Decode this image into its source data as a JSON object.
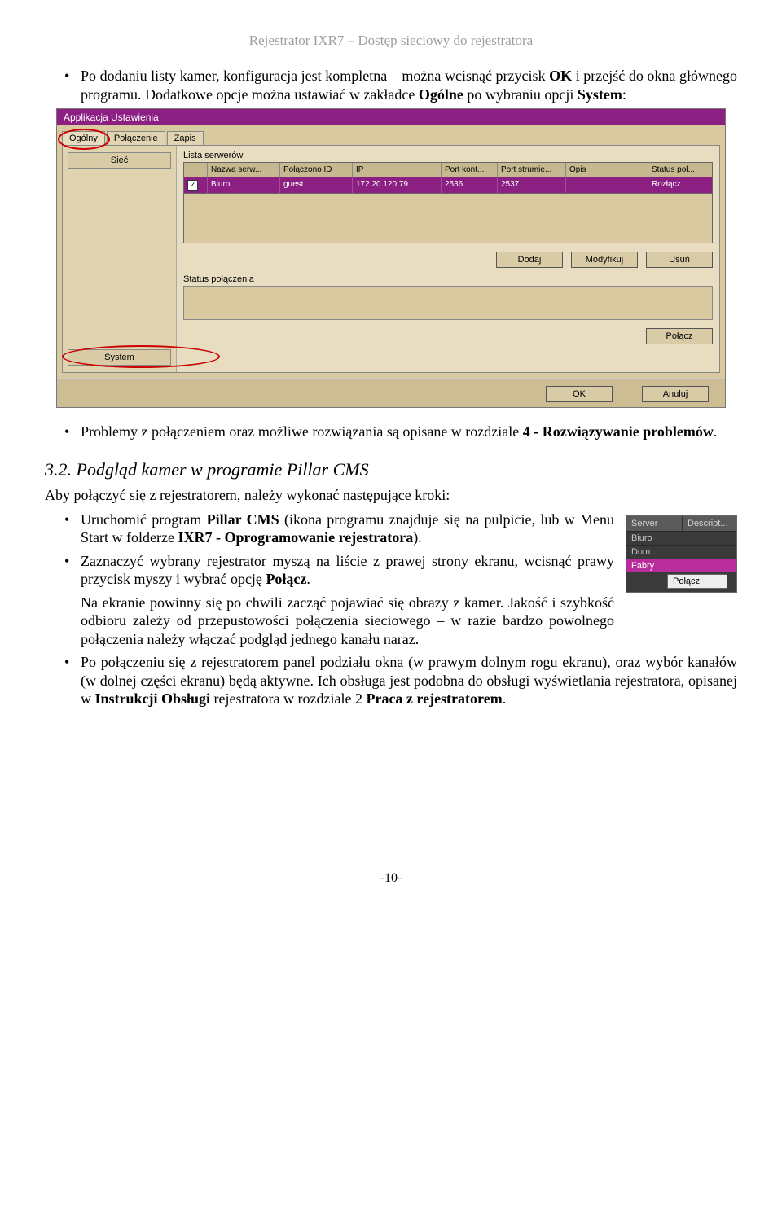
{
  "header": "Rejestrator IXR7 – Dostęp sieciowy do rejestratora",
  "intro_list": [
    {
      "pre": "Po dodaniu listy kamer, konfiguracja jest kompletna – można wcisnąć przycisk ",
      "b1": "OK",
      "mid": " i przejść do okna głównego programu. Dodatkowe opcje można ustawiać w zakładce ",
      "b2": "Ogólne",
      "mid2": " po wybraniu opcji ",
      "b3": "System",
      "post": ":"
    }
  ],
  "window": {
    "title": "Applikacja Ustawienia",
    "tabs": {
      "t1": "Ogólny",
      "t2": "Połączenie",
      "t3": "Zapis"
    },
    "left": {
      "top_btn": "Sieć",
      "bottom_btn": "System"
    },
    "list_label": "Lista serwerów",
    "headers": {
      "name": "Nazwa serw...",
      "id": "Połączono ID",
      "ip": "IP",
      "portk": "Port kont...",
      "ports": "Port strumie...",
      "opis": "Opis",
      "status": "Status poł..."
    },
    "row": {
      "name": "Biuro",
      "id": "guest",
      "ip": "172.20.120.79",
      "portk": "2536",
      "ports": "2537",
      "opis": "",
      "status": "Rozłącz"
    },
    "buttons": {
      "add": "Dodaj",
      "mod": "Modyfikuj",
      "del": "Usuń",
      "connect": "Połącz",
      "ok": "OK",
      "cancel": "Anuluj"
    },
    "status_label": "Status połączenia"
  },
  "mid_list": {
    "text_pre": "Problemy z połączeniem oraz możliwe rozwiązania są opisane w rozdziale ",
    "b1": "4 - Rozwiązywanie problemów",
    "post": "."
  },
  "heading": "3.2. Podgląd kamer w programie Pillar CMS",
  "intro2": "Aby połączyć się z rejestratorem, należy wykonać następujące kroki:",
  "mini": {
    "h1": "Server",
    "h2": "Descript...",
    "r1": "Biuro",
    "r2": "Dom",
    "r3": "Fabry",
    "menu": "Połącz"
  },
  "steps": {
    "s1_pre": "Uruchomić program ",
    "s1_b1": "Pillar CMS",
    "s1_mid": " (ikona programu znajduje się na pulpicie, lub w Menu Start w folderze ",
    "s1_b2": "IXR7 - Oprogramowanie rejestratora",
    "s1_post": ").",
    "s2_pre": "Zaznaczyć wybrany rejestrator myszą na liście z prawej strony ekranu, wcisnąć prawy przycisk myszy i wybrać opcję ",
    "s2_b1": "Połącz",
    "s2_post": ".",
    "s2b": "Na ekranie powinny się po chwili zacząć pojawiać się obrazy z kamer. Jakość i szybkość odbioru zależy od przepustowości połączenia sieciowego – w razie bardzo powolnego połączenia należy włączać podgląd jednego kanału naraz.",
    "s3_pre": "Po połączeniu się z rejestratorem panel podziału okna (w prawym dolnym rogu ekranu), oraz wybór kanałów (w dolnej części ekranu) będą aktywne. Ich obsługa jest podobna do obsługi wyświetlania rejestratora, opisanej w ",
    "s3_b1": "Instrukcji Obsługi",
    "s3_mid": " rejestratora w rozdziale 2 ",
    "s3_b2": "Praca z rejestratorem",
    "s3_post": "."
  },
  "page_number": "-10-"
}
